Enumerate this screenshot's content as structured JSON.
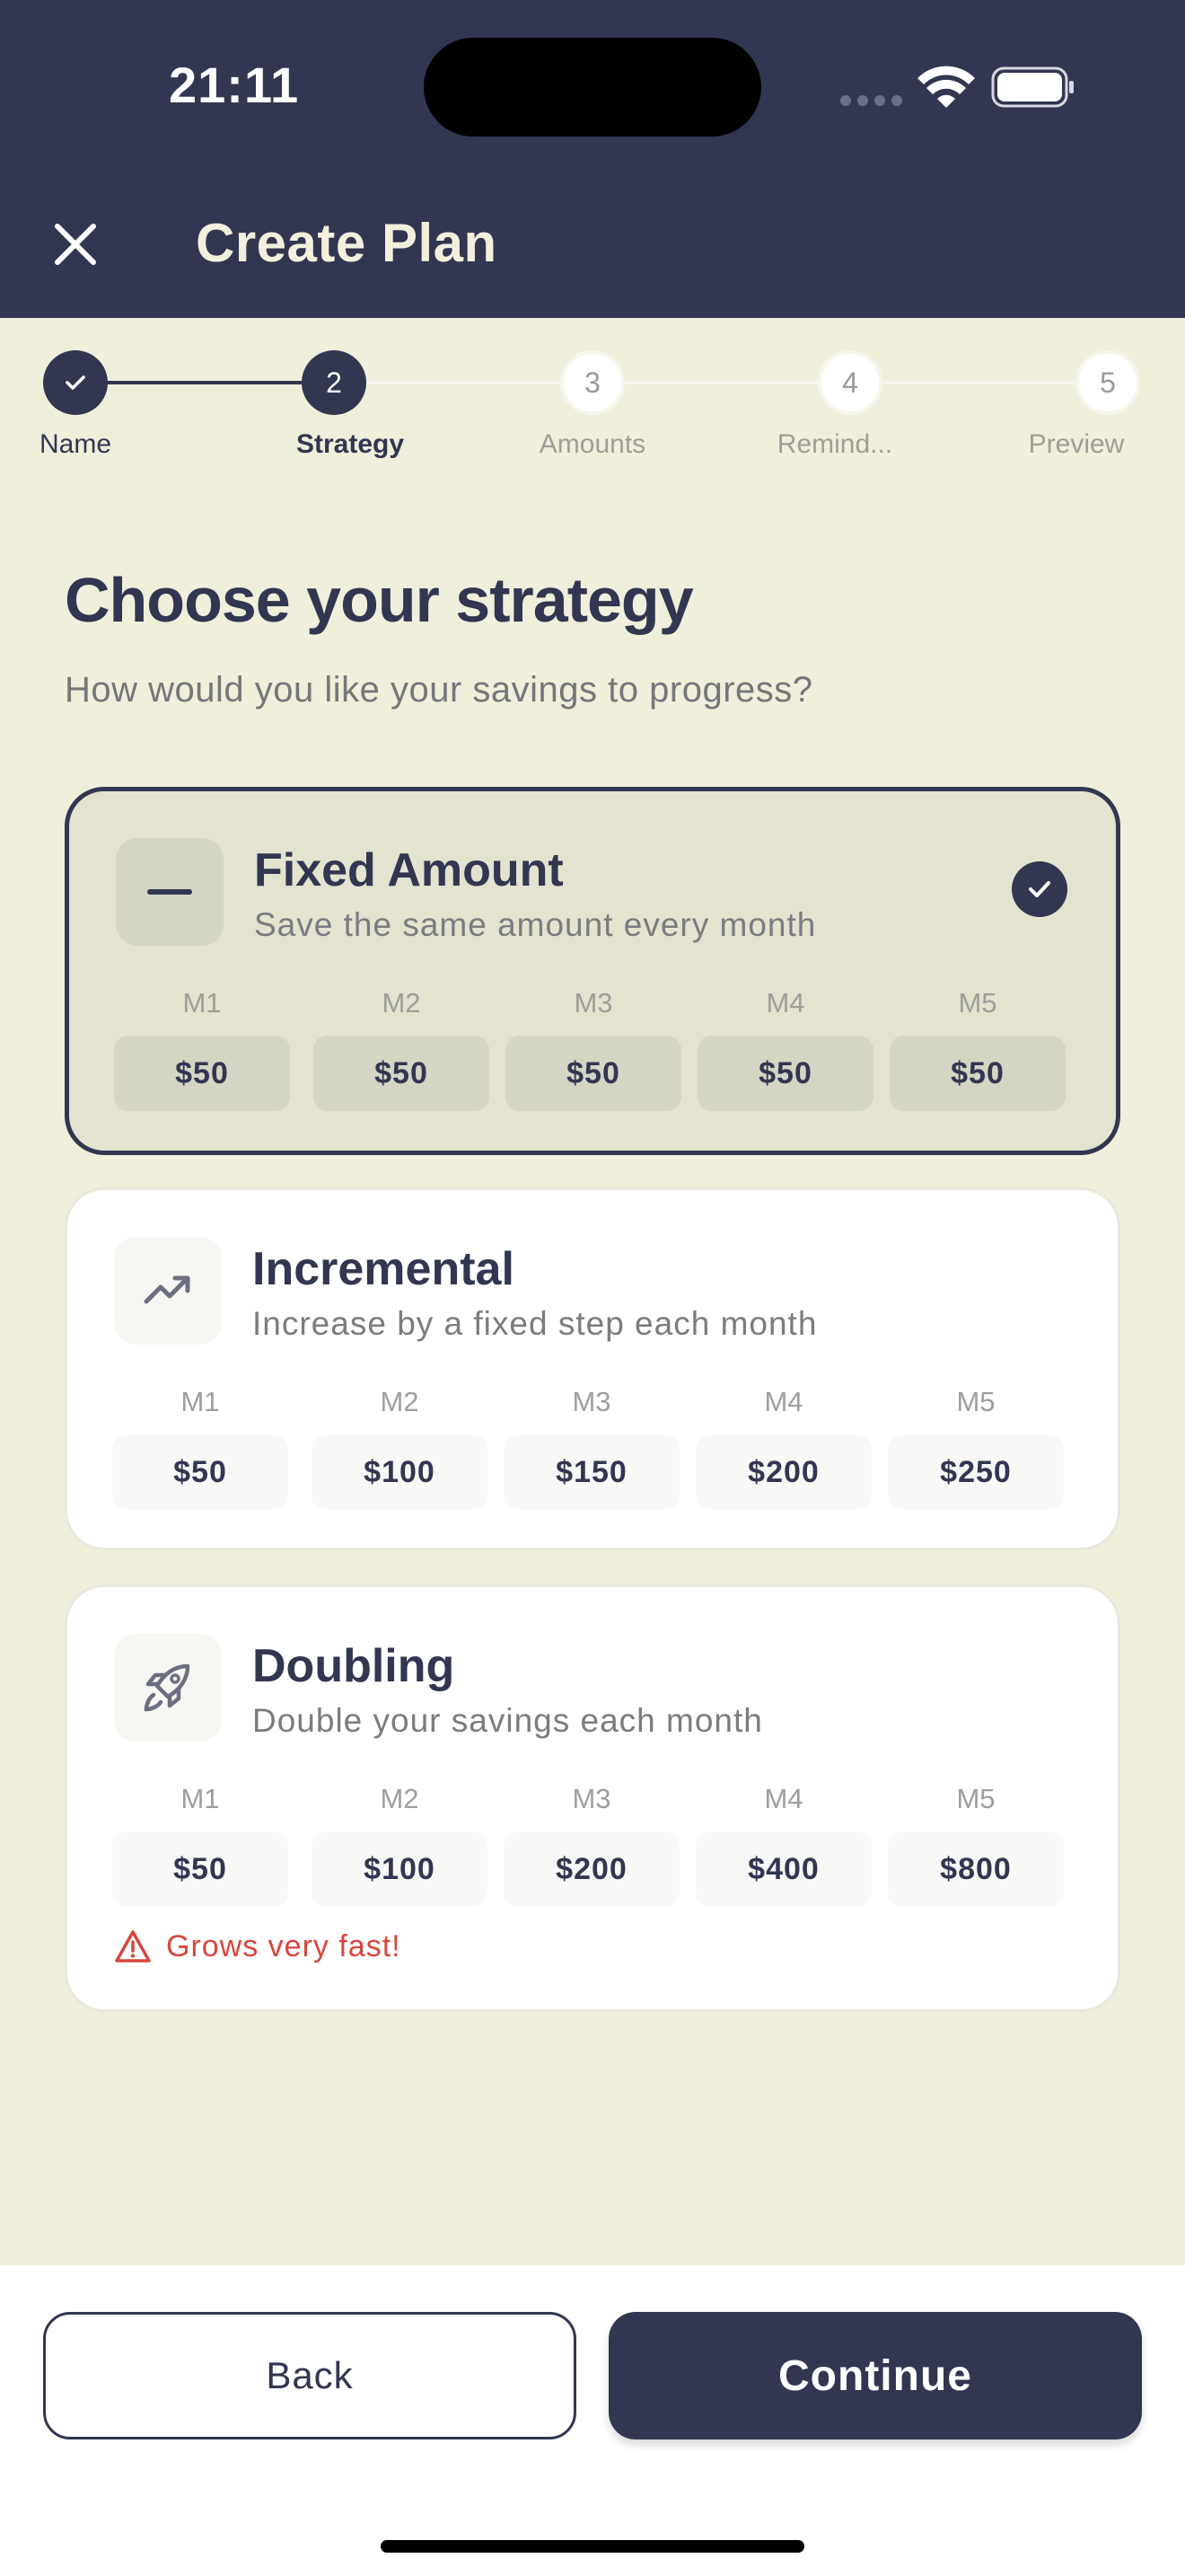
{
  "status_bar": {
    "time": "21:11"
  },
  "header": {
    "title": "Create Plan",
    "close_icon": "close-icon"
  },
  "stepper": {
    "steps": [
      {
        "number": "1",
        "label": "Name",
        "state": "done"
      },
      {
        "number": "2",
        "label": "Strategy",
        "state": "current"
      },
      {
        "number": "3",
        "label": "Amounts",
        "state": "todo"
      },
      {
        "number": "4",
        "label": "Remind...",
        "state": "todo"
      },
      {
        "number": "5",
        "label": "Preview",
        "state": "todo"
      }
    ]
  },
  "main": {
    "title": "Choose your strategy",
    "subtitle": "How would you like your savings to progress?"
  },
  "strategies": [
    {
      "title": "Fixed Amount",
      "description": "Save the same amount every month",
      "icon": "minus-icon",
      "selected": true,
      "months": [
        {
          "label": "M1",
          "value": "$50"
        },
        {
          "label": "M2",
          "value": "$50"
        },
        {
          "label": "M3",
          "value": "$50"
        },
        {
          "label": "M4",
          "value": "$50"
        },
        {
          "label": "M5",
          "value": "$50"
        }
      ]
    },
    {
      "title": "Incremental",
      "description": "Increase by a fixed step each month",
      "icon": "trending-up-icon",
      "selected": false,
      "months": [
        {
          "label": "M1",
          "value": "$50"
        },
        {
          "label": "M2",
          "value": "$100"
        },
        {
          "label": "M3",
          "value": "$150"
        },
        {
          "label": "M4",
          "value": "$200"
        },
        {
          "label": "M5",
          "value": "$250"
        }
      ]
    },
    {
      "title": "Doubling",
      "description": "Double your savings each month",
      "icon": "rocket-icon",
      "selected": false,
      "warning": "Grows very fast!",
      "months": [
        {
          "label": "M1",
          "value": "$50"
        },
        {
          "label": "M2",
          "value": "$100"
        },
        {
          "label": "M3",
          "value": "$200"
        },
        {
          "label": "M4",
          "value": "$400"
        },
        {
          "label": "M5",
          "value": "$800"
        }
      ]
    }
  ],
  "footer": {
    "back_label": "Back",
    "continue_label": "Continue"
  },
  "colors": {
    "primary": "#323651",
    "background": "#efefdb",
    "warning": "#d8463f"
  }
}
